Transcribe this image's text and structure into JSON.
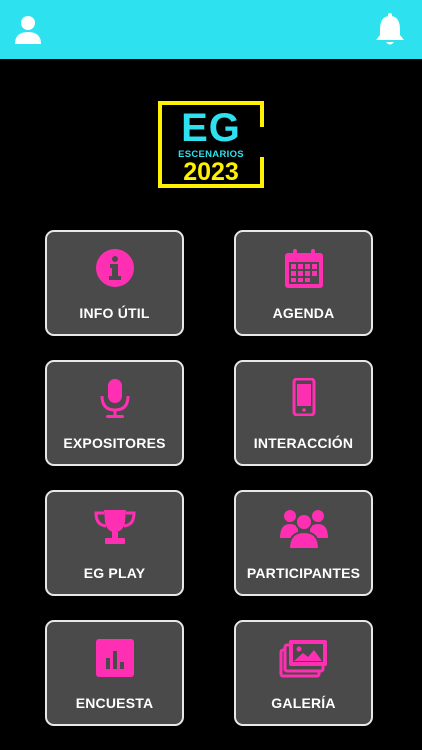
{
  "header": {
    "user_icon": "user-icon",
    "bell_icon": "bell-icon",
    "background": "#2ee1ee"
  },
  "logo": {
    "title": "EG",
    "subtitle": "ESCENARIOS",
    "year": "2023",
    "frame_color": "#fff200"
  },
  "menu": {
    "accent": "#ff2fb3",
    "items": [
      {
        "label": "INFO ÚTIL",
        "icon": "info-icon"
      },
      {
        "label": "AGENDA",
        "icon": "calendar-icon"
      },
      {
        "label": "EXPOSITORES",
        "icon": "microphone-icon"
      },
      {
        "label": "INTERACCIÓN",
        "icon": "smartphone-icon"
      },
      {
        "label": "EG PLAY",
        "icon": "trophy-icon"
      },
      {
        "label": "PARTICIPANTES",
        "icon": "users-icon"
      },
      {
        "label": "ENCUESTA",
        "icon": "bar-chart-icon"
      },
      {
        "label": "GALERÍA",
        "icon": "gallery-icon"
      }
    ]
  }
}
